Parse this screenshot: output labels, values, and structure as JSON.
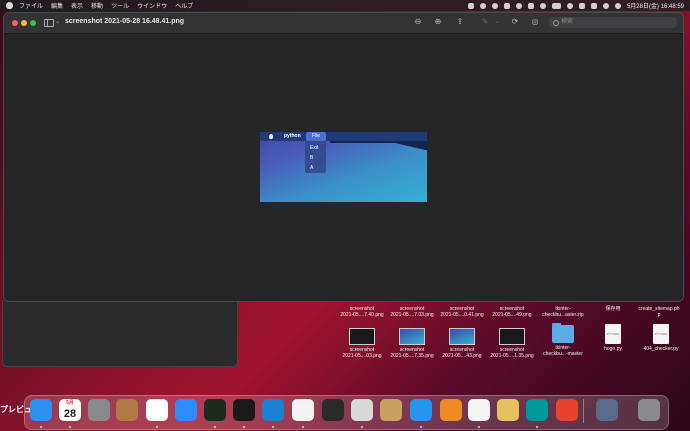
{
  "menubar": {
    "items": [
      "プレビュー",
      "ファイル",
      "編集",
      "表示",
      "移動",
      "ツール",
      "ウインドウ",
      "ヘルプ"
    ],
    "clock": "5月28日(金)  16:48:59"
  },
  "window": {
    "title": "screenshot 2021-05-28 16.48.41.png",
    "search_placeholder": "検索"
  },
  "embedded": {
    "app_name": "python",
    "menu": "File",
    "dropdown": [
      "Exit",
      "B",
      "A"
    ]
  },
  "desktop": {
    "row1_labels": [
      "screenshot\n2021-05....7.40.png",
      "screenshot\n2021-05....7.03.png",
      "screenshot\n2021-05....0.41.png",
      "screenshot\n2021-05....49.png",
      "tkinter-\ncheckbu...aster.zip",
      "保存用",
      "create_sitemap.ph\np"
    ],
    "row2": [
      {
        "label": "screenshot\n2021-05....03.png",
        "kind": "dark"
      },
      {
        "label": "screenshot\n2021-05....7.35.png",
        "kind": "blue"
      },
      {
        "label": "screenshot\n2021-05....43.png",
        "kind": "blue"
      },
      {
        "label": "screenshot\n2021-05....1.35.png",
        "kind": "dark"
      },
      {
        "label": "tkinter-\ncheckbu...-master",
        "kind": "folder"
      },
      {
        "label": "hoge.py",
        "kind": "doc"
      },
      {
        "label": "404_checker.py",
        "kind": "doc"
      }
    ]
  },
  "dock": {
    "calendar_month": "5月",
    "calendar_day": "28",
    "apps": [
      {
        "name": "finder",
        "color": "#2e8ff0"
      },
      {
        "name": "calendar",
        "color": "#ffffff"
      },
      {
        "name": "system-preferences",
        "color": "#8a8a8e"
      },
      {
        "name": "contacts",
        "color": "#b07a45"
      },
      {
        "name": "chrome",
        "color": "#ffffff"
      },
      {
        "name": "zoom",
        "color": "#2d8cff"
      },
      {
        "name": "activity-monitor",
        "color": "#1f2a1f"
      },
      {
        "name": "terminal",
        "color": "#1a1a1a"
      },
      {
        "name": "vscode",
        "color": "#1b7fd4"
      },
      {
        "name": "safari",
        "color": "#f2f2f2"
      },
      {
        "name": "quicktime",
        "color": "#2a2a2a"
      },
      {
        "name": "sequel",
        "color": "#d8d8d8"
      },
      {
        "name": "archive-utility",
        "color": "#c8a060"
      },
      {
        "name": "docker",
        "color": "#2496ed"
      },
      {
        "name": "sourcetree",
        "color": "#f08a24"
      },
      {
        "name": "app-2",
        "color": "#f4f4f4"
      },
      {
        "name": "preview",
        "color": "#e8c060"
      },
      {
        "name": "arduino",
        "color": "#00979d"
      },
      {
        "name": "clock",
        "color": "#e8412c"
      },
      {
        "name": "photo",
        "color": "#5a6a8a"
      },
      {
        "name": "trash",
        "color": "#8a8a8e"
      }
    ]
  }
}
